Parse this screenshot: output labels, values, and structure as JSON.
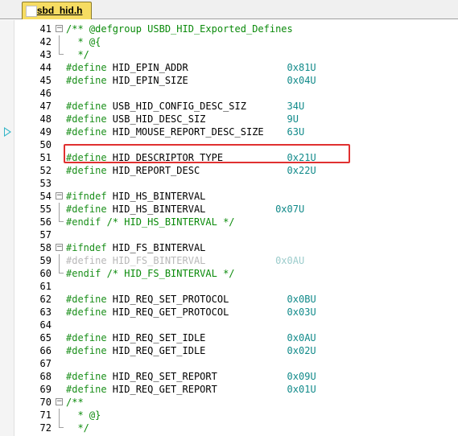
{
  "tab": {
    "label": "usbd_hid.h"
  },
  "lines": [
    {
      "n": "41",
      "fold": "box",
      "parts": [
        {
          "t": "/** @defgroup USBD_HID_Exported_Defines",
          "c": "comment"
        }
      ]
    },
    {
      "n": "42",
      "fold": "line",
      "parts": [
        {
          "t": "  * @{",
          "c": "comment"
        }
      ]
    },
    {
      "n": "43",
      "fold": "end",
      "parts": [
        {
          "t": "  */",
          "c": "comment"
        }
      ]
    },
    {
      "n": "44",
      "parts": [
        {
          "t": "#define ",
          "c": "pp"
        },
        {
          "t": "HID_EPIN_ADDR",
          "c": "plain"
        },
        {
          "t": "                 0x81U",
          "c": "num"
        }
      ]
    },
    {
      "n": "45",
      "parts": [
        {
          "t": "#define ",
          "c": "pp"
        },
        {
          "t": "HID_EPIN_SIZE",
          "c": "plain"
        },
        {
          "t": "                 0x04U",
          "c": "num"
        }
      ]
    },
    {
      "n": "46",
      "parts": []
    },
    {
      "n": "47",
      "parts": [
        {
          "t": "#define ",
          "c": "pp"
        },
        {
          "t": "USB_HID_CONFIG_DESC_SIZ",
          "c": "plain"
        },
        {
          "t": "       34U",
          "c": "num"
        }
      ]
    },
    {
      "n": "48",
      "parts": [
        {
          "t": "#define ",
          "c": "pp"
        },
        {
          "t": "USB_HID_DESC_SIZ",
          "c": "plain"
        },
        {
          "t": "              9U",
          "c": "num"
        }
      ]
    },
    {
      "n": "49",
      "marker": true,
      "parts": [
        {
          "t": "#define ",
          "c": "pp"
        },
        {
          "t": "HID_MOUSE_REPORT_DESC_SIZE",
          "c": "plain"
        },
        {
          "t": "    63U",
          "c": "num"
        }
      ]
    },
    {
      "n": "50",
      "parts": []
    },
    {
      "n": "51",
      "parts": [
        {
          "t": "#define ",
          "c": "pp"
        },
        {
          "t": "HID_DESCRIPTOR_TYPE",
          "c": "plain"
        },
        {
          "t": "           0x21U",
          "c": "num"
        }
      ]
    },
    {
      "n": "52",
      "parts": [
        {
          "t": "#define ",
          "c": "pp"
        },
        {
          "t": "HID_REPORT_DESC",
          "c": "plain"
        },
        {
          "t": "               0x22U",
          "c": "num"
        }
      ]
    },
    {
      "n": "53",
      "parts": []
    },
    {
      "n": "54",
      "fold": "box",
      "parts": [
        {
          "t": "#ifndef ",
          "c": "pp"
        },
        {
          "t": "HID_HS_BINTERVAL",
          "c": "plain"
        }
      ]
    },
    {
      "n": "55",
      "fold": "line",
      "parts": [
        {
          "t": "#define ",
          "c": "pp"
        },
        {
          "t": "HID_HS_BINTERVAL",
          "c": "plain"
        },
        {
          "t": "            0x07U",
          "c": "num"
        }
      ]
    },
    {
      "n": "56",
      "fold": "end",
      "parts": [
        {
          "t": "#endif ",
          "c": "pp"
        },
        {
          "t": "/* HID_HS_BINTERVAL */",
          "c": "comment"
        }
      ]
    },
    {
      "n": "57",
      "parts": []
    },
    {
      "n": "58",
      "fold": "box",
      "parts": [
        {
          "t": "#ifndef ",
          "c": "pp"
        },
        {
          "t": "HID_FS_BINTERVAL",
          "c": "plain"
        }
      ]
    },
    {
      "n": "59",
      "fold": "line",
      "dim": true,
      "parts": [
        {
          "t": "#define ",
          "c": "pp"
        },
        {
          "t": "HID_FS_BINTERVAL",
          "c": "plain"
        },
        {
          "t": "            0x0AU",
          "c": "num"
        }
      ]
    },
    {
      "n": "60",
      "fold": "end",
      "parts": [
        {
          "t": "#endif ",
          "c": "pp"
        },
        {
          "t": "/* HID_FS_BINTERVAL */",
          "c": "comment"
        }
      ]
    },
    {
      "n": "61",
      "parts": []
    },
    {
      "n": "62",
      "parts": [
        {
          "t": "#define ",
          "c": "pp"
        },
        {
          "t": "HID_REQ_SET_PROTOCOL",
          "c": "plain"
        },
        {
          "t": "          0x0BU",
          "c": "num"
        }
      ]
    },
    {
      "n": "63",
      "parts": [
        {
          "t": "#define ",
          "c": "pp"
        },
        {
          "t": "HID_REQ_GET_PROTOCOL",
          "c": "plain"
        },
        {
          "t": "          0x03U",
          "c": "num"
        }
      ]
    },
    {
      "n": "64",
      "parts": []
    },
    {
      "n": "65",
      "parts": [
        {
          "t": "#define ",
          "c": "pp"
        },
        {
          "t": "HID_REQ_SET_IDLE",
          "c": "plain"
        },
        {
          "t": "              0x0AU",
          "c": "num"
        }
      ]
    },
    {
      "n": "66",
      "parts": [
        {
          "t": "#define ",
          "c": "pp"
        },
        {
          "t": "HID_REQ_GET_IDLE",
          "c": "plain"
        },
        {
          "t": "              0x02U",
          "c": "num"
        }
      ]
    },
    {
      "n": "67",
      "parts": []
    },
    {
      "n": "68",
      "parts": [
        {
          "t": "#define ",
          "c": "pp"
        },
        {
          "t": "HID_REQ_SET_REPORT",
          "c": "plain"
        },
        {
          "t": "            0x09U",
          "c": "num"
        }
      ]
    },
    {
      "n": "69",
      "parts": [
        {
          "t": "#define ",
          "c": "pp"
        },
        {
          "t": "HID_REQ_GET_REPORT",
          "c": "plain"
        },
        {
          "t": "            0x01U",
          "c": "num"
        }
      ]
    },
    {
      "n": "70",
      "fold": "box",
      "parts": [
        {
          "t": "/**",
          "c": "comment"
        }
      ]
    },
    {
      "n": "71",
      "fold": "line",
      "parts": [
        {
          "t": "  * @}",
          "c": "comment"
        }
      ]
    },
    {
      "n": "72",
      "fold": "end",
      "parts": [
        {
          "t": "  */",
          "c": "comment"
        }
      ]
    }
  ],
  "colors": {
    "tab_background": "#f6dc62",
    "highlight_border": "#e03030",
    "marker": "#35b6c8",
    "comment": "#0a8a0a",
    "number": "#118a8a"
  },
  "icons": {
    "marker": "current-line-arrow-icon",
    "fold": "fold-toggle-icon"
  }
}
